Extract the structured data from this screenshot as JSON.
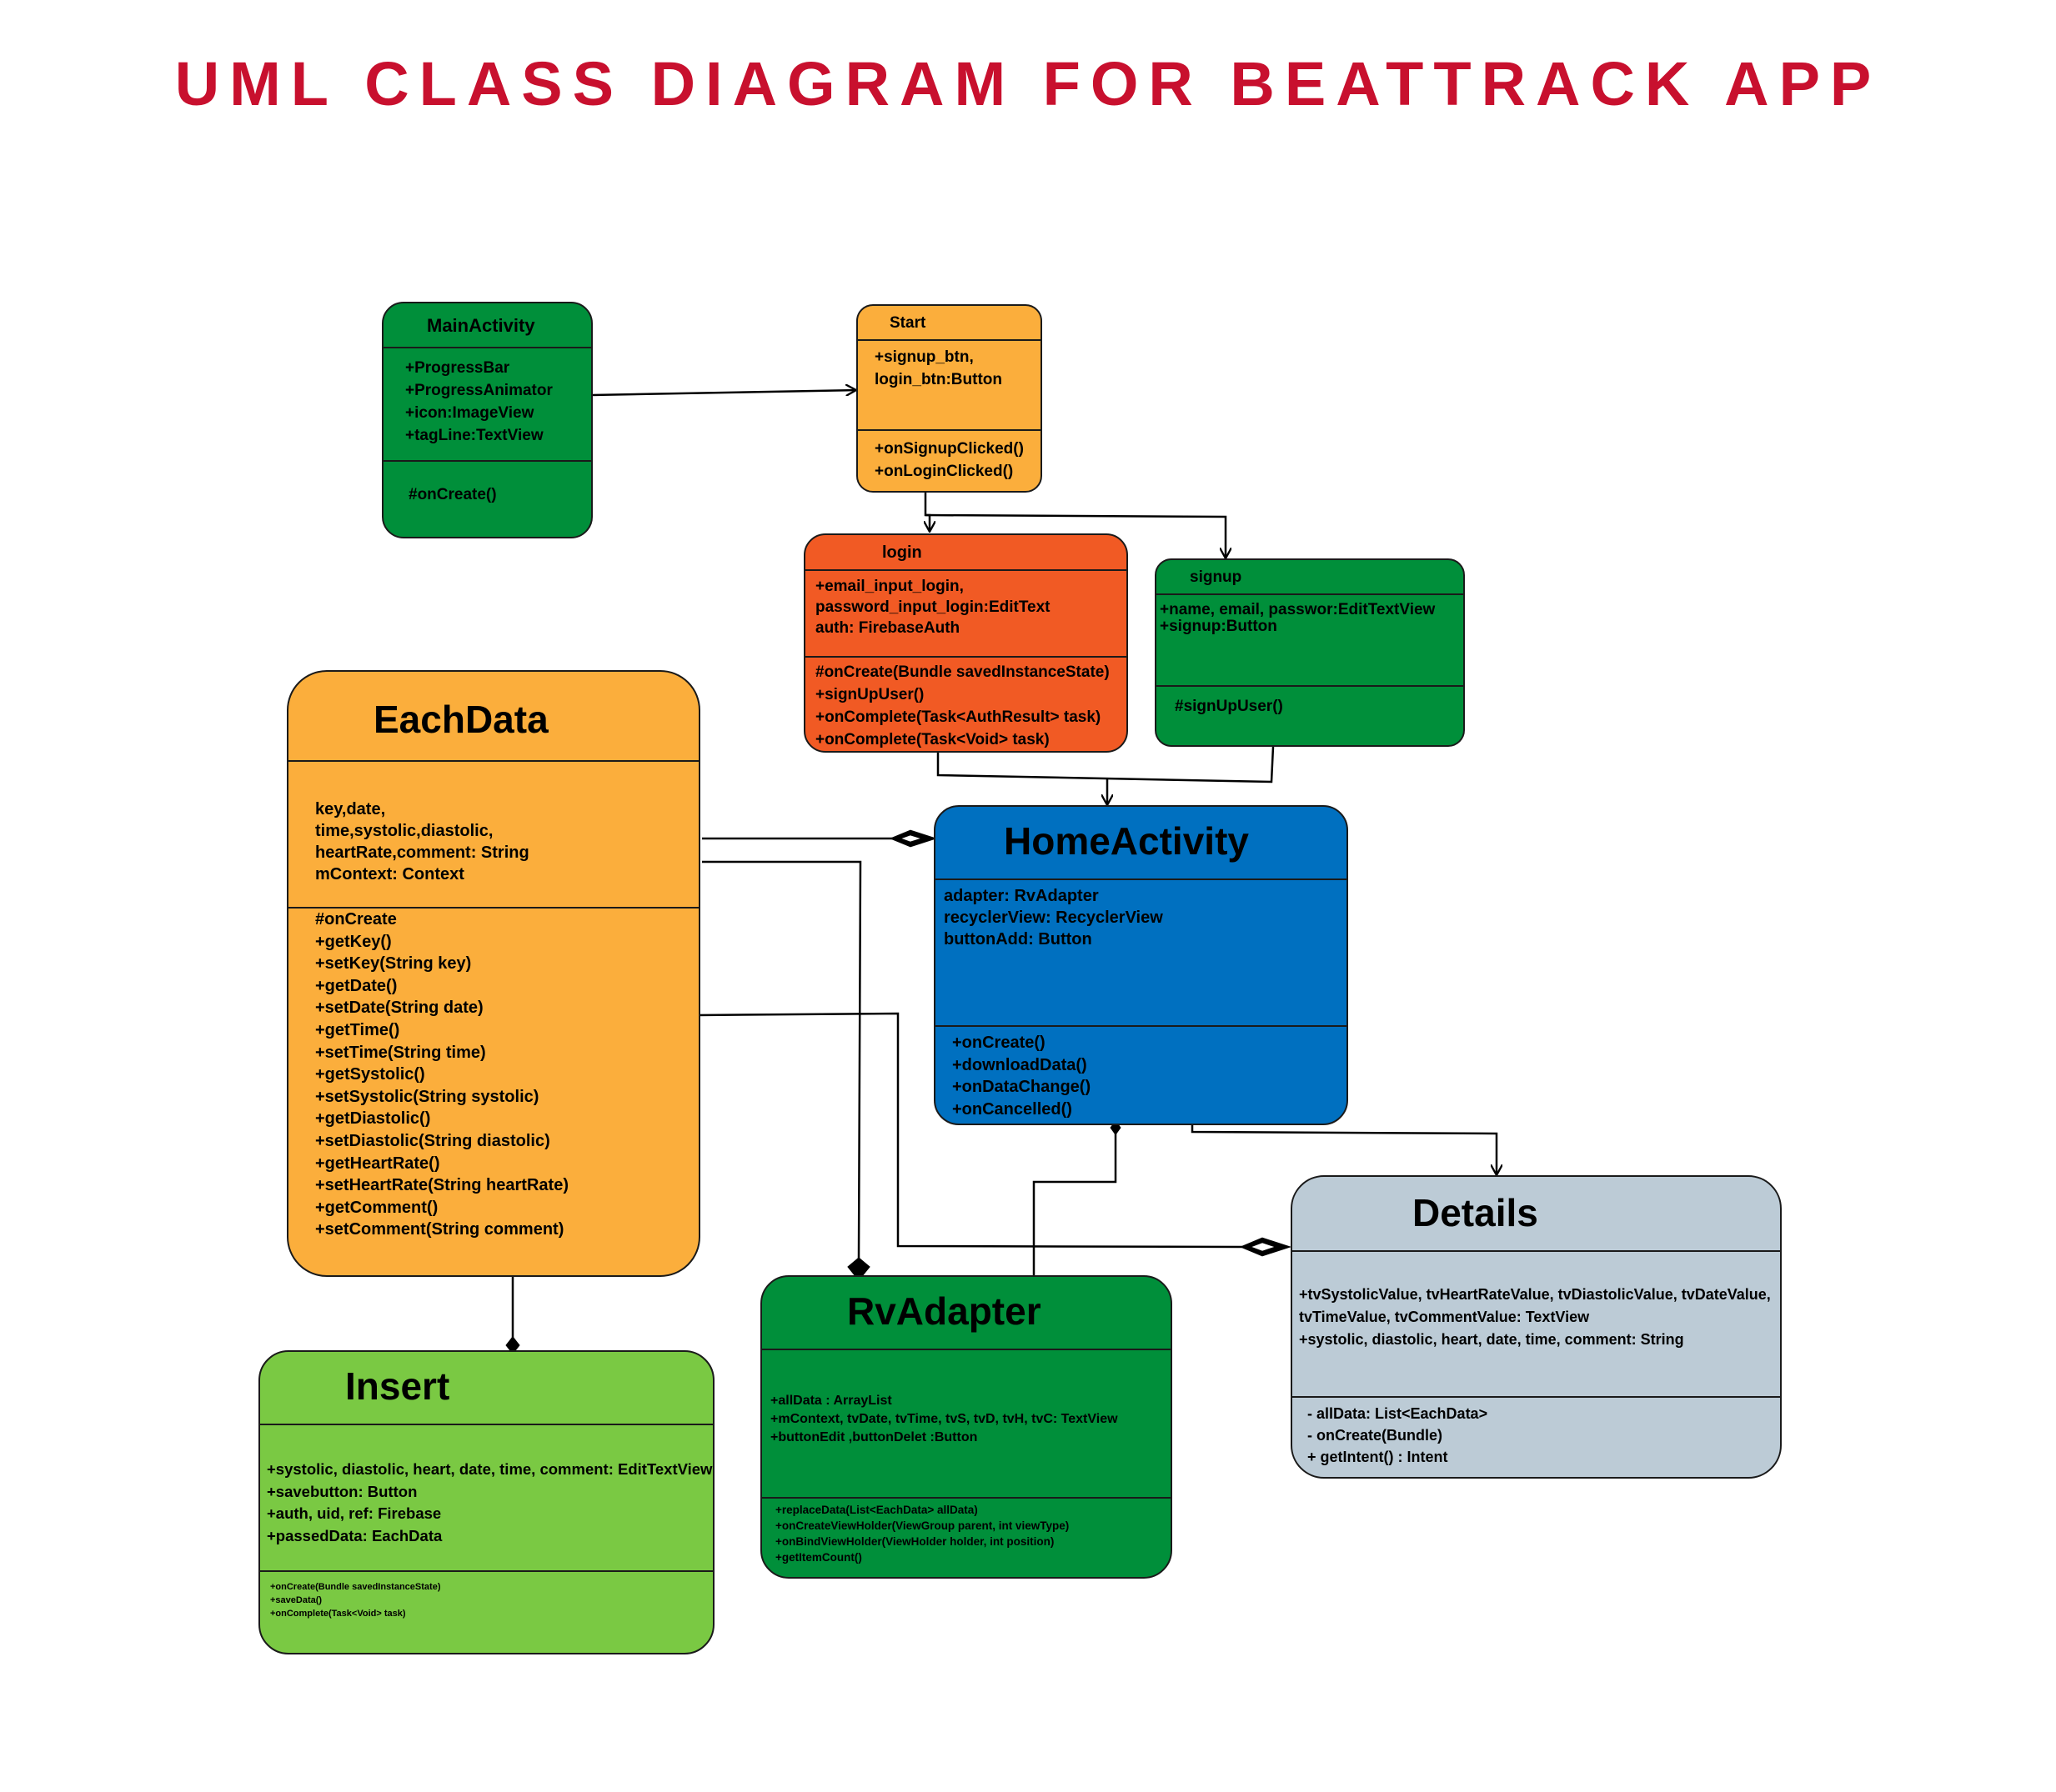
{
  "title": "UML CLASS DIAGRAM FOR BEATTRACK APP",
  "colors": {
    "title": "#c8102e",
    "green": "#008f3a",
    "orange": "#fbae3c",
    "red_orange": "#f15a24",
    "blue": "#0070c0",
    "light_green": "#7ac943",
    "gray_blue": "#bccbd6"
  },
  "classes": {
    "main_activity": {
      "name": "MainActivity",
      "attributes": [
        "+ProgressBar",
        "+ProgressAnimator",
        "+icon:ImageView",
        "+tagLine:TextView"
      ],
      "methods": [
        "#onCreate()"
      ]
    },
    "start": {
      "name": "Start",
      "attributes": [
        "+signup_btn,",
        "login_btn:Button"
      ],
      "methods": [
        "+onSignupClicked()",
        "+onLoginClicked()"
      ]
    },
    "login": {
      "name": "login",
      "attributes": [
        "+email_input_login,",
        "password_input_login:EditText",
        "auth: FirebaseAuth"
      ],
      "methods": [
        "#onCreate(Bundle savedInstanceState)",
        "+signUpUser()",
        "+onComplete(Task<AuthResult> task)",
        "+onComplete(Task<Void> task)"
      ]
    },
    "signup": {
      "name": "signup",
      "attributes": [
        "+name, email, passwor:EditTextView",
        "+signup:Button"
      ],
      "methods": [
        "#signUpUser()"
      ]
    },
    "each_data": {
      "name": "EachData",
      "attributes": [
        "key,date,",
        "time,systolic,diastolic,",
        "heartRate,comment: String",
        "mContext: Context"
      ],
      "methods": [
        "#onCreate",
        "+getKey()",
        "+setKey(String key)",
        "+getDate()",
        "+setDate(String date)",
        "+getTime()",
        "+setTime(String time)",
        "+getSystolic()",
        "+setSystolic(String systolic)",
        "+getDiastolic()",
        "+setDiastolic(String diastolic)",
        "+getHeartRate()",
        "+setHeartRate(String heartRate)",
        "+getComment()",
        "+setComment(String comment)"
      ]
    },
    "home_activity": {
      "name": "HomeActivity",
      "attributes": [
        "adapter: RvAdapter",
        "recyclerView: RecyclerView",
        "buttonAdd: Button"
      ],
      "methods": [
        "+onCreate()",
        "+downloadData()",
        "+onDataChange()",
        "+onCancelled()"
      ]
    },
    "details": {
      "name": "Details",
      "attributes": [
        "+tvSystolicValue, tvHeartRateValue, tvDiastolicValue, tvDateValue,",
        "tvTimeValue, tvCommentValue: TextView",
        "+systolic, diastolic, heart, date, time, comment: String"
      ],
      "methods": [
        "- allData: List<EachData>",
        "- onCreate(Bundle)",
        "+ getIntent() : Intent"
      ]
    },
    "rv_adapter": {
      "name": "RvAdapter",
      "attributes": [
        "+allData : ArrayList",
        "+mContext, tvDate, tvTime, tvS, tvD, tvH, tvC: TextView",
        "+buttonEdit ,buttonDelet :Button"
      ],
      "methods": [
        "+replaceData(List<EachData> allData)",
        "+onCreateViewHolder(ViewGroup parent, int viewType)",
        "+onBindViewHolder(ViewHolder holder, int position)",
        "+getItemCount()"
      ]
    },
    "insert": {
      "name": "Insert",
      "attributes": [
        "+systolic, diastolic, heart, date, time, comment: EditTextView",
        "+savebutton: Button",
        "+auth, uid, ref: Firebase",
        "+passedData: EachData"
      ],
      "methods": [
        "+onCreate(Bundle savedInstanceState)",
        "+saveData()",
        "+onComplete(Task<Void> task)"
      ]
    }
  }
}
